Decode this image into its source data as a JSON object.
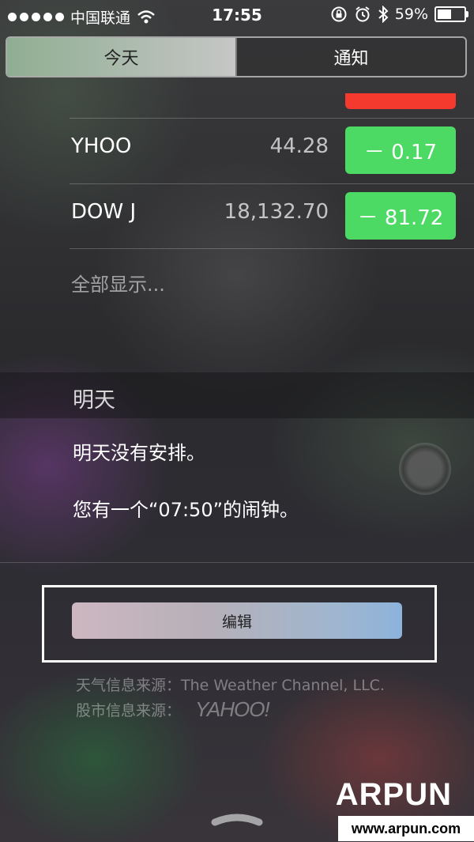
{
  "status_bar": {
    "carrier": "中国联通",
    "time": "17:55",
    "battery_percent": "59%",
    "battery_level": 0.59
  },
  "tabs": [
    {
      "label": "今天",
      "active": true
    },
    {
      "label": "通知",
      "active": false
    }
  ],
  "stocks": [
    {
      "symbol": "YHOO",
      "price": "44.28",
      "change": "－ 0.17",
      "change_color": "#4cd964"
    },
    {
      "symbol": "DOW J",
      "price": "18,132.70",
      "change": "－ 81.72",
      "change_color": "#4cd964"
    }
  ],
  "show_all_label": "全部显示...",
  "tomorrow": {
    "header": "明天",
    "lines": [
      "明天没有安排。",
      "您有一个“07:50”的闹钟。"
    ]
  },
  "edit_label": "编辑",
  "credits": {
    "weather": "天气信息来源：The Weather Channel, LLC.",
    "stocks_prefix": "股市信息来源：",
    "stocks_logo_text": "YAHOO!"
  },
  "watermark": {
    "brand": "ARPUN",
    "url": "www.arpun.com"
  },
  "icons": [
    "signal-dots-icon",
    "wifi-icon",
    "rotation-lock-icon",
    "alarm-icon",
    "bluetooth-icon",
    "battery-icon",
    "grabber-chevron-icon"
  ]
}
